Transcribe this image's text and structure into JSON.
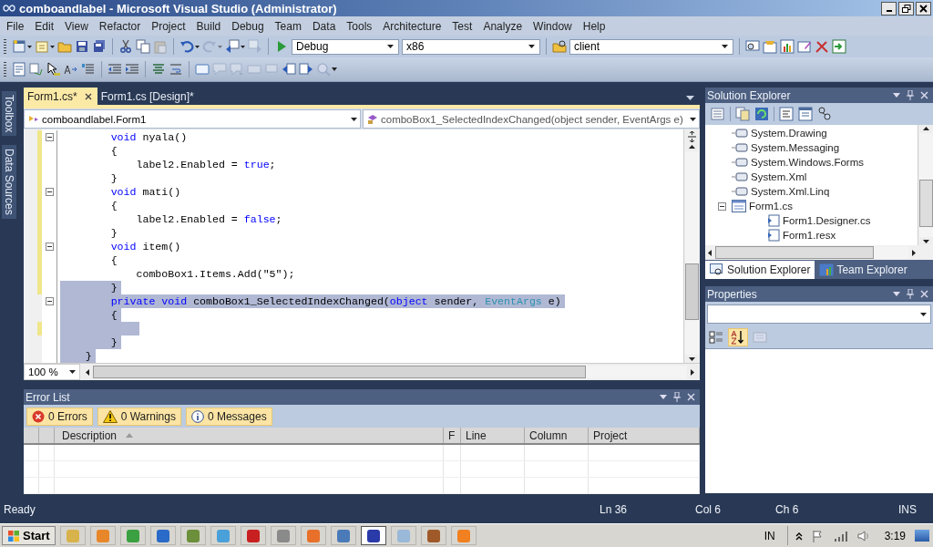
{
  "window": {
    "title": "comboandlabel - Microsoft Visual Studio (Administrator)"
  },
  "menu": [
    "File",
    "Edit",
    "View",
    "Refactor",
    "Project",
    "Build",
    "Debug",
    "Team",
    "Data",
    "Tools",
    "Architecture",
    "Test",
    "Analyze",
    "Window",
    "Help"
  ],
  "toolbar": {
    "configuration": "Debug",
    "platform": "x86",
    "find": "client"
  },
  "side_tabs": [
    "Toolbox",
    "Data Sources"
  ],
  "doc_tabs": [
    {
      "label": "Form1.cs*",
      "selected": true
    },
    {
      "label": "Form1.cs [Design]*",
      "selected": false
    }
  ],
  "editor": {
    "class_nav": "comboandlabel.Form1",
    "member_nav": "comboBox1_SelectedIndexChanged(object sender, EventArgs e)",
    "zoom": "100 %",
    "lines": [
      {
        "kind": "member",
        "fold": true,
        "modified": true,
        "selected": false,
        "tokens": [
          {
            "t": "void",
            "kind": "keyword"
          },
          {
            "t": " nyala()",
            "kind": "plain"
          }
        ]
      },
      {
        "kind": "member",
        "fold": false,
        "modified": true,
        "selected": false,
        "tokens": [
          {
            "t": "{",
            "kind": "plain"
          }
        ]
      },
      {
        "kind": "statement",
        "fold": false,
        "modified": true,
        "selected": false,
        "tokens": [
          {
            "t": "label2.Enabled = ",
            "kind": "plain"
          },
          {
            "t": "true",
            "kind": "keyword"
          },
          {
            "t": ";",
            "kind": "plain"
          }
        ]
      },
      {
        "kind": "member",
        "fold": false,
        "modified": true,
        "selected": false,
        "tokens": [
          {
            "t": "}",
            "kind": "plain"
          }
        ]
      },
      {
        "kind": "member",
        "fold": true,
        "modified": true,
        "selected": false,
        "tokens": [
          {
            "t": "void",
            "kind": "keyword"
          },
          {
            "t": " mati()",
            "kind": "plain"
          }
        ]
      },
      {
        "kind": "member",
        "fold": false,
        "modified": true,
        "selected": false,
        "tokens": [
          {
            "t": "{",
            "kind": "plain"
          }
        ]
      },
      {
        "kind": "statement",
        "fold": false,
        "modified": true,
        "selected": false,
        "tokens": [
          {
            "t": "label2.Enabled = ",
            "kind": "plain"
          },
          {
            "t": "false",
            "kind": "keyword"
          },
          {
            "t": ";",
            "kind": "plain"
          }
        ]
      },
      {
        "kind": "member",
        "fold": false,
        "modified": true,
        "selected": false,
        "tokens": [
          {
            "t": "}",
            "kind": "plain"
          }
        ]
      },
      {
        "kind": "member",
        "fold": true,
        "modified": true,
        "selected": false,
        "tokens": [
          {
            "t": "void",
            "kind": "keyword"
          },
          {
            "t": " item()",
            "kind": "plain"
          }
        ]
      },
      {
        "kind": "member",
        "fold": false,
        "modified": true,
        "selected": false,
        "tokens": [
          {
            "t": "{",
            "kind": "plain"
          }
        ]
      },
      {
        "kind": "statement",
        "fold": false,
        "modified": true,
        "selected": false,
        "tokens": [
          {
            "t": "comboBox1.Items.Add(\"5\");",
            "kind": "plain"
          }
        ]
      },
      {
        "kind": "member",
        "fold": false,
        "modified": true,
        "selected": true,
        "tokens": [
          {
            "t": "}",
            "kind": "plain"
          }
        ]
      },
      {
        "kind": "member",
        "fold": true,
        "modified": false,
        "selected": true,
        "tokens": [
          {
            "t": "private ",
            "kind": "keyword"
          },
          {
            "t": "void",
            "kind": "keyword"
          },
          {
            "t": " comboBox1_SelectedIndexChanged(",
            "kind": "plain"
          },
          {
            "t": "object",
            "kind": "keyword"
          },
          {
            "t": " sender, ",
            "kind": "plain"
          },
          {
            "t": "EventArgs",
            "kind": "type"
          },
          {
            "t": " e)",
            "kind": "plain"
          }
        ]
      },
      {
        "kind": "member",
        "fold": false,
        "modified": false,
        "selected": true,
        "tokens": [
          {
            "t": "{",
            "kind": "plain"
          }
        ]
      },
      {
        "kind": "statement",
        "fold": false,
        "modified": true,
        "selected": true
      },
      {
        "kind": "member",
        "fold": false,
        "modified": false,
        "selected": true,
        "tokens": [
          {
            "t": "}",
            "kind": "plain"
          }
        ]
      },
      {
        "kind": "class",
        "fold": false,
        "modified": false,
        "selected": true,
        "tokens": [
          {
            "t": "}",
            "kind": "plain"
          }
        ]
      }
    ]
  },
  "error_list": {
    "title": "Error List",
    "filters": [
      {
        "kind": "error",
        "label": "0 Errors"
      },
      {
        "kind": "warning",
        "label": "0 Warnings"
      },
      {
        "kind": "info",
        "label": "0 Messages"
      }
    ],
    "columns": [
      "Description",
      "F",
      "Line",
      "Column",
      "Project"
    ]
  },
  "solution_explorer": {
    "title": "Solution Explorer",
    "items": [
      {
        "label": "System.Drawing",
        "kind": "reference"
      },
      {
        "label": "System.Messaging",
        "kind": "reference"
      },
      {
        "label": "System.Windows.Forms",
        "kind": "reference"
      },
      {
        "label": "System.Xml",
        "kind": "reference"
      },
      {
        "label": "System.Xml.Linq",
        "kind": "reference"
      },
      {
        "label": "Form1.cs",
        "kind": "form",
        "expanded": true,
        "children": [
          {
            "label": "Form1.Designer.cs",
            "kind": "file"
          },
          {
            "label": "Form1.resx",
            "kind": "file"
          }
        ]
      }
    ],
    "tabs": [
      {
        "label": "Solution Explorer",
        "selected": true
      },
      {
        "label": "Team Explorer",
        "selected": false
      }
    ]
  },
  "properties": {
    "title": "Properties"
  },
  "status_bar": {
    "message": "Ready",
    "line": "Ln 36",
    "col": "Col 6",
    "ch": "Ch 6",
    "mode": "INS"
  },
  "taskbar": {
    "start": "Start",
    "language": "IN",
    "time": "3:19"
  }
}
